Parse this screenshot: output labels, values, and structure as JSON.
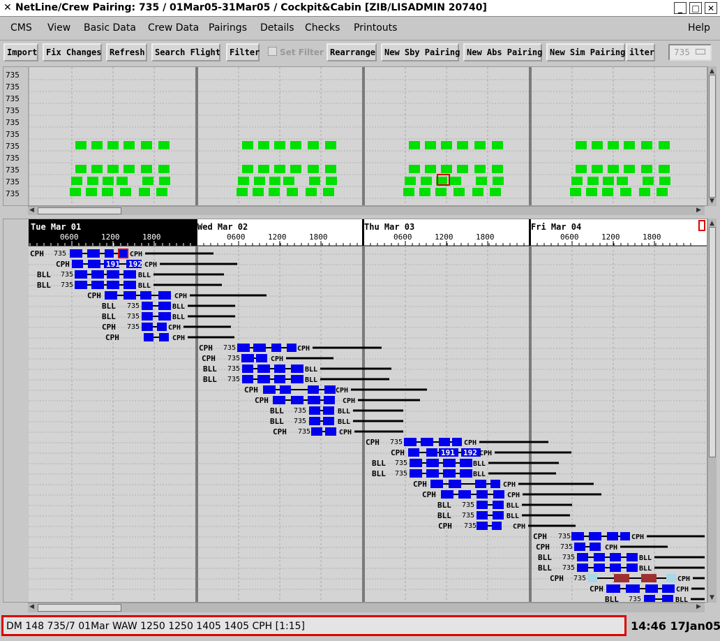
{
  "window": {
    "title": "NetLine/Crew Pairing: 735 / 01Mar05-31Mar05 / Cockpit&Cabin   [ZIB/LISADMIN 20740]"
  },
  "menu": [
    "CMS",
    "View",
    "Basic Data",
    "Crew Data",
    "Pairings",
    "Details",
    "Checks",
    "Printouts",
    "Help"
  ],
  "toolbar": {
    "buttons": [
      "Import",
      "Fix Changes",
      "Refresh",
      "Search Flight",
      "Filter",
      "Rearrange",
      "New Sby Pairing",
      "New Abs Pairing",
      "New Sim Pairing",
      "ilter"
    ],
    "set_filter_label": "Set Filter",
    "fleet_value": "735"
  },
  "top_panel": {
    "row_labels": [
      "735",
      "735",
      "735",
      "735",
      "735",
      "735",
      "735",
      "735",
      "735",
      "735",
      "735"
    ]
  },
  "timeline": {
    "days": [
      "Tue Mar 01",
      "Wed Mar 02",
      "Thu Mar 03",
      "Fri Mar 04"
    ],
    "hours": [
      "0600",
      "1200",
      "1800"
    ]
  },
  "status": {
    "text": "DM 148  735/7  01Mar  WAW 1250 1250  1405 1405  CPH   [1:15]",
    "clock": "14:46 17Jan05"
  },
  "colors": {
    "leg_blue": "#0000ee",
    "leg_green": "#00e000",
    "leg_dark_red": "#a03030",
    "leg_light_blue": "#a8d8e8",
    "highlight_red": "#d00000"
  },
  "pairings": [
    {
      "start_station": "CPH",
      "fleet": "735",
      "end_station": "CPH",
      "tag1": "",
      "tag2": ""
    },
    {
      "start_station": "CPH",
      "fleet": "",
      "end_station": "CPH",
      "tag1": "191",
      "tag2": "192"
    },
    {
      "start_station": "BLL",
      "fleet": "735",
      "end_station": "BLL",
      "tag1": "",
      "tag2": ""
    },
    {
      "start_station": "BLL",
      "fleet": "735",
      "end_station": "BLL",
      "tag1": "",
      "tag2": ""
    },
    {
      "start_station": "CPH",
      "fleet": "",
      "end_station": "CPH",
      "tag1": "",
      "tag2": ""
    },
    {
      "start_station": "BLL",
      "fleet": "735",
      "end_station": "BLL",
      "tag1": "",
      "tag2": ""
    },
    {
      "start_station": "BLL",
      "fleet": "735",
      "end_station": "BLL",
      "tag1": "",
      "tag2": ""
    },
    {
      "start_station": "CPH",
      "fleet": "735",
      "end_station": "CPH",
      "tag1": "",
      "tag2": ""
    },
    {
      "start_station": "CPH",
      "fleet": "",
      "end_station": "CPH",
      "tag1": "",
      "tag2": ""
    },
    {
      "start_station": "CPH",
      "fleet": "735",
      "end_station": "CPH",
      "tag1": "",
      "tag2": ""
    },
    {
      "start_station": "CPH",
      "fleet": "735",
      "end_station": "CPH",
      "tag1": "",
      "tag2": ""
    },
    {
      "start_station": "BLL",
      "fleet": "735",
      "end_station": "BLL",
      "tag1": "",
      "tag2": ""
    },
    {
      "start_station": "BLL",
      "fleet": "735",
      "end_station": "BLL",
      "tag1": "",
      "tag2": ""
    },
    {
      "start_station": "CPH",
      "fleet": "",
      "end_station": "CPH",
      "tag1": "",
      "tag2": ""
    },
    {
      "start_station": "CPH",
      "fleet": "",
      "end_station": "CPH",
      "tag1": "",
      "tag2": ""
    },
    {
      "start_station": "BLL",
      "fleet": "735",
      "end_station": "BLL",
      "tag1": "",
      "tag2": ""
    },
    {
      "start_station": "BLL",
      "fleet": "735",
      "end_station": "BLL",
      "tag1": "",
      "tag2": ""
    },
    {
      "start_station": "CPH",
      "fleet": "735",
      "end_station": "CPH",
      "tag1": "",
      "tag2": ""
    },
    {
      "start_station": "CPH",
      "fleet": "735",
      "end_station": "CPH",
      "tag1": "",
      "tag2": ""
    },
    {
      "start_station": "CPH",
      "fleet": "",
      "end_station": "CPH",
      "tag1": "191",
      "tag2": "192"
    },
    {
      "start_station": "BLL",
      "fleet": "735",
      "end_station": "BLL",
      "tag1": "",
      "tag2": ""
    },
    {
      "start_station": "BLL",
      "fleet": "735",
      "end_station": "BLL",
      "tag1": "",
      "tag2": ""
    },
    {
      "start_station": "CPH",
      "fleet": "",
      "end_station": "CPH",
      "tag1": "",
      "tag2": ""
    },
    {
      "start_station": "CPH",
      "fleet": "",
      "end_station": "CPH",
      "tag1": "",
      "tag2": ""
    },
    {
      "start_station": "BLL",
      "fleet": "735",
      "end_station": "BLL",
      "tag1": "",
      "tag2": ""
    },
    {
      "start_station": "BLL",
      "fleet": "735",
      "end_station": "BLL",
      "tag1": "",
      "tag2": ""
    },
    {
      "start_station": "CPH",
      "fleet": "735",
      "end_station": "CPH",
      "tag1": "",
      "tag2": ""
    },
    {
      "start_station": "CPH",
      "fleet": "735",
      "end_station": "CPH",
      "tag1": "",
      "tag2": ""
    },
    {
      "start_station": "CPH",
      "fleet": "735",
      "end_station": "CPH",
      "tag1": "",
      "tag2": ""
    },
    {
      "start_station": "BLL",
      "fleet": "735",
      "end_station": "BLL",
      "tag1": "",
      "tag2": ""
    },
    {
      "start_station": "BLL",
      "fleet": "735",
      "end_station": "BLL",
      "tag1": "",
      "tag2": ""
    },
    {
      "start_station": "CPH",
      "fleet": "735",
      "end_station": "CPH",
      "tag1": "",
      "tag2": ""
    },
    {
      "start_station": "CPH",
      "fleet": "",
      "end_station": "CPH",
      "tag1": "",
      "tag2": ""
    },
    {
      "start_station": "BLL",
      "fleet": "735",
      "end_station": "BLL",
      "tag1": "",
      "tag2": ""
    }
  ]
}
